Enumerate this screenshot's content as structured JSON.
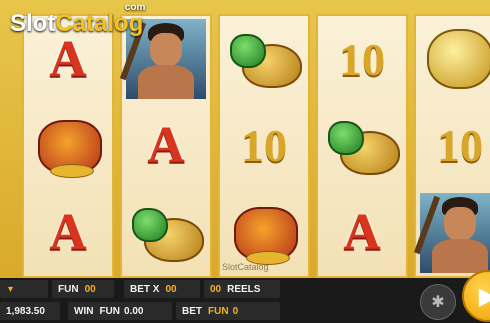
{
  "logo": {
    "brand_main": "Slot",
    "brand_accent": "Catalog",
    "suffix": "com"
  },
  "watermark": "SlotCatalog",
  "reels": [
    [
      "A",
      "lion",
      "A"
    ],
    [
      "hunter",
      "A",
      "turtle"
    ],
    [
      "turtle",
      "10",
      "lion"
    ],
    [
      "10",
      "turtle",
      "A"
    ],
    [
      "gold-toad",
      "10",
      "hunter"
    ]
  ],
  "bottom_bar": {
    "balance_value": "1,983.50",
    "fun_label": "FUN",
    "fun_value": "00",
    "betx_label": "BET X",
    "betx_value": "00",
    "reels_value": "00",
    "reels_label": "REELS",
    "win_label": "WIN",
    "win_currency": "FUN",
    "win_value": "0.00",
    "bet_label": "BET",
    "bet_currency": "FUN",
    "bet_value": "0"
  },
  "buttons": {
    "autoplay_icon": "runner-icon",
    "spin_icon": "play-icon"
  },
  "colors": {
    "accent": "#f5b223",
    "frame": "#e3b43c",
    "reel_bg": "#fbf1d8",
    "symbol_red": "#d8351f"
  }
}
